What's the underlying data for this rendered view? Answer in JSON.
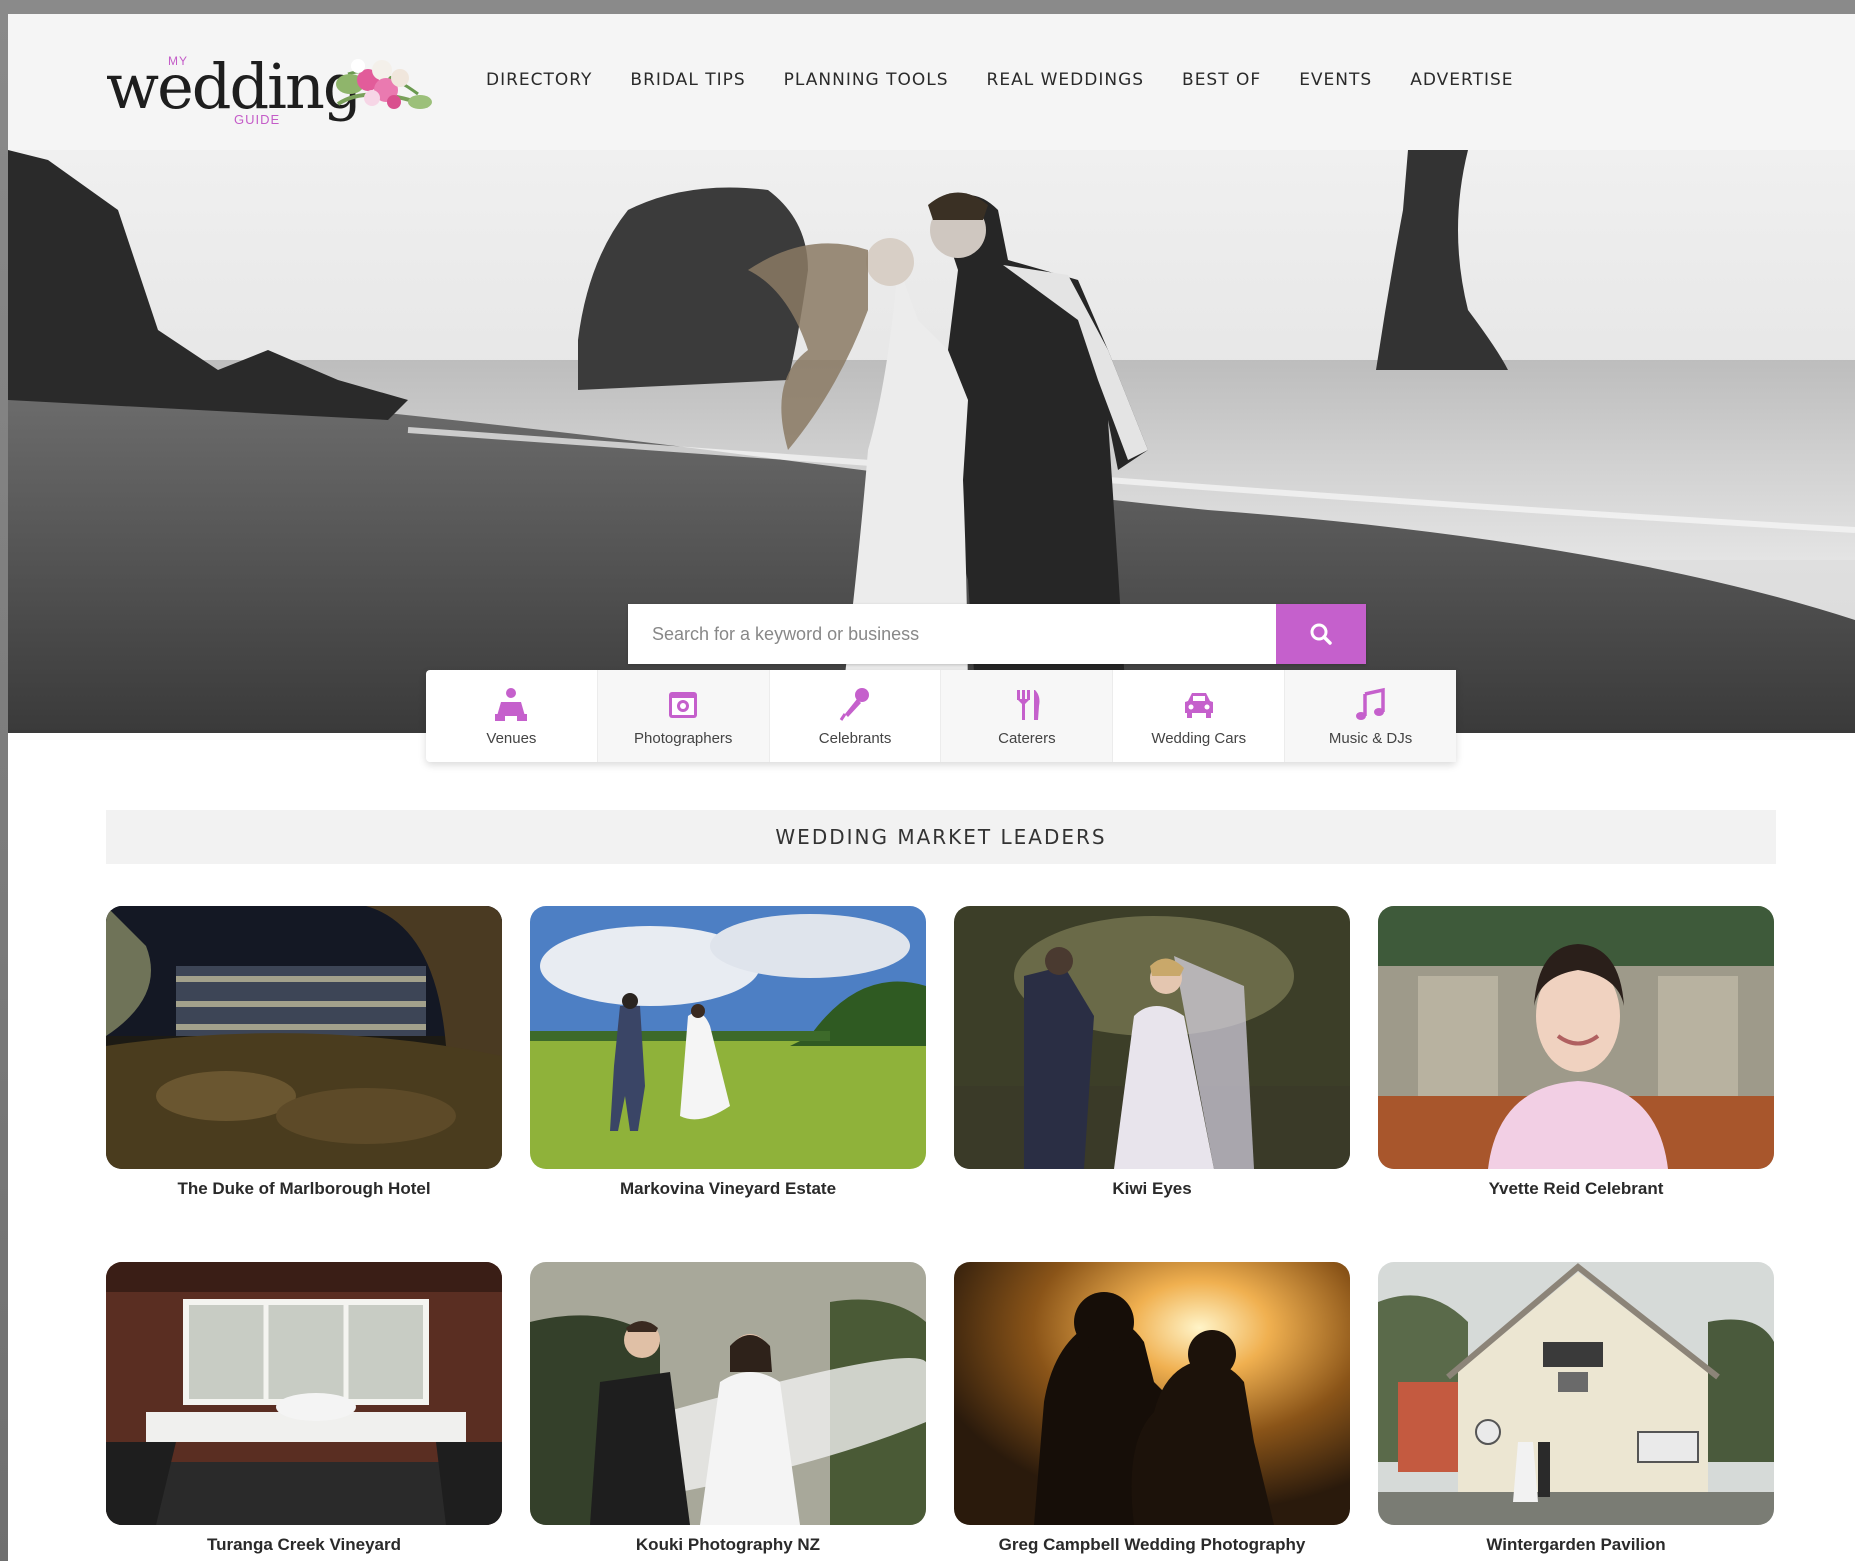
{
  "header": {
    "logo": {
      "my": "MY",
      "wedding": "wedding",
      "guide": "GUIDE"
    },
    "nav": [
      {
        "label": "DIRECTORY"
      },
      {
        "label": "BRIDAL TIPS"
      },
      {
        "label": "PLANNING TOOLS"
      },
      {
        "label": "REAL WEDDINGS"
      },
      {
        "label": "BEST OF"
      },
      {
        "label": "EVENTS"
      },
      {
        "label": "ADVERTISE"
      }
    ]
  },
  "hero": {
    "search": {
      "placeholder": "Search for a keyword or business",
      "button_icon": "search-icon"
    }
  },
  "categories": [
    {
      "label": "Venues",
      "icon": "venues-icon"
    },
    {
      "label": "Photographers",
      "icon": "camera-icon"
    },
    {
      "label": "Celebrants",
      "icon": "microphone-icon"
    },
    {
      "label": "Caterers",
      "icon": "fork-knife-icon"
    },
    {
      "label": "Wedding Cars",
      "icon": "car-icon"
    },
    {
      "label": "Music & DJs",
      "icon": "music-note-icon"
    }
  ],
  "section": {
    "title": "WEDDING MARKET LEADERS"
  },
  "leaders": [
    {
      "title": "The Duke of Marlborough Hotel"
    },
    {
      "title": "Markovina Vineyard Estate"
    },
    {
      "title": "Kiwi Eyes"
    },
    {
      "title": "Yvette Reid Celebrant"
    },
    {
      "title": "Turanga Creek Vineyard"
    },
    {
      "title": "Kouki Photography NZ"
    },
    {
      "title": "Greg Campbell Wedding Photography"
    },
    {
      "title": "Wintergarden Pavilion"
    }
  ],
  "colors": {
    "accent": "#c560cc",
    "header_bg": "#f5f5f5",
    "section_bg": "#f2f2f2"
  }
}
